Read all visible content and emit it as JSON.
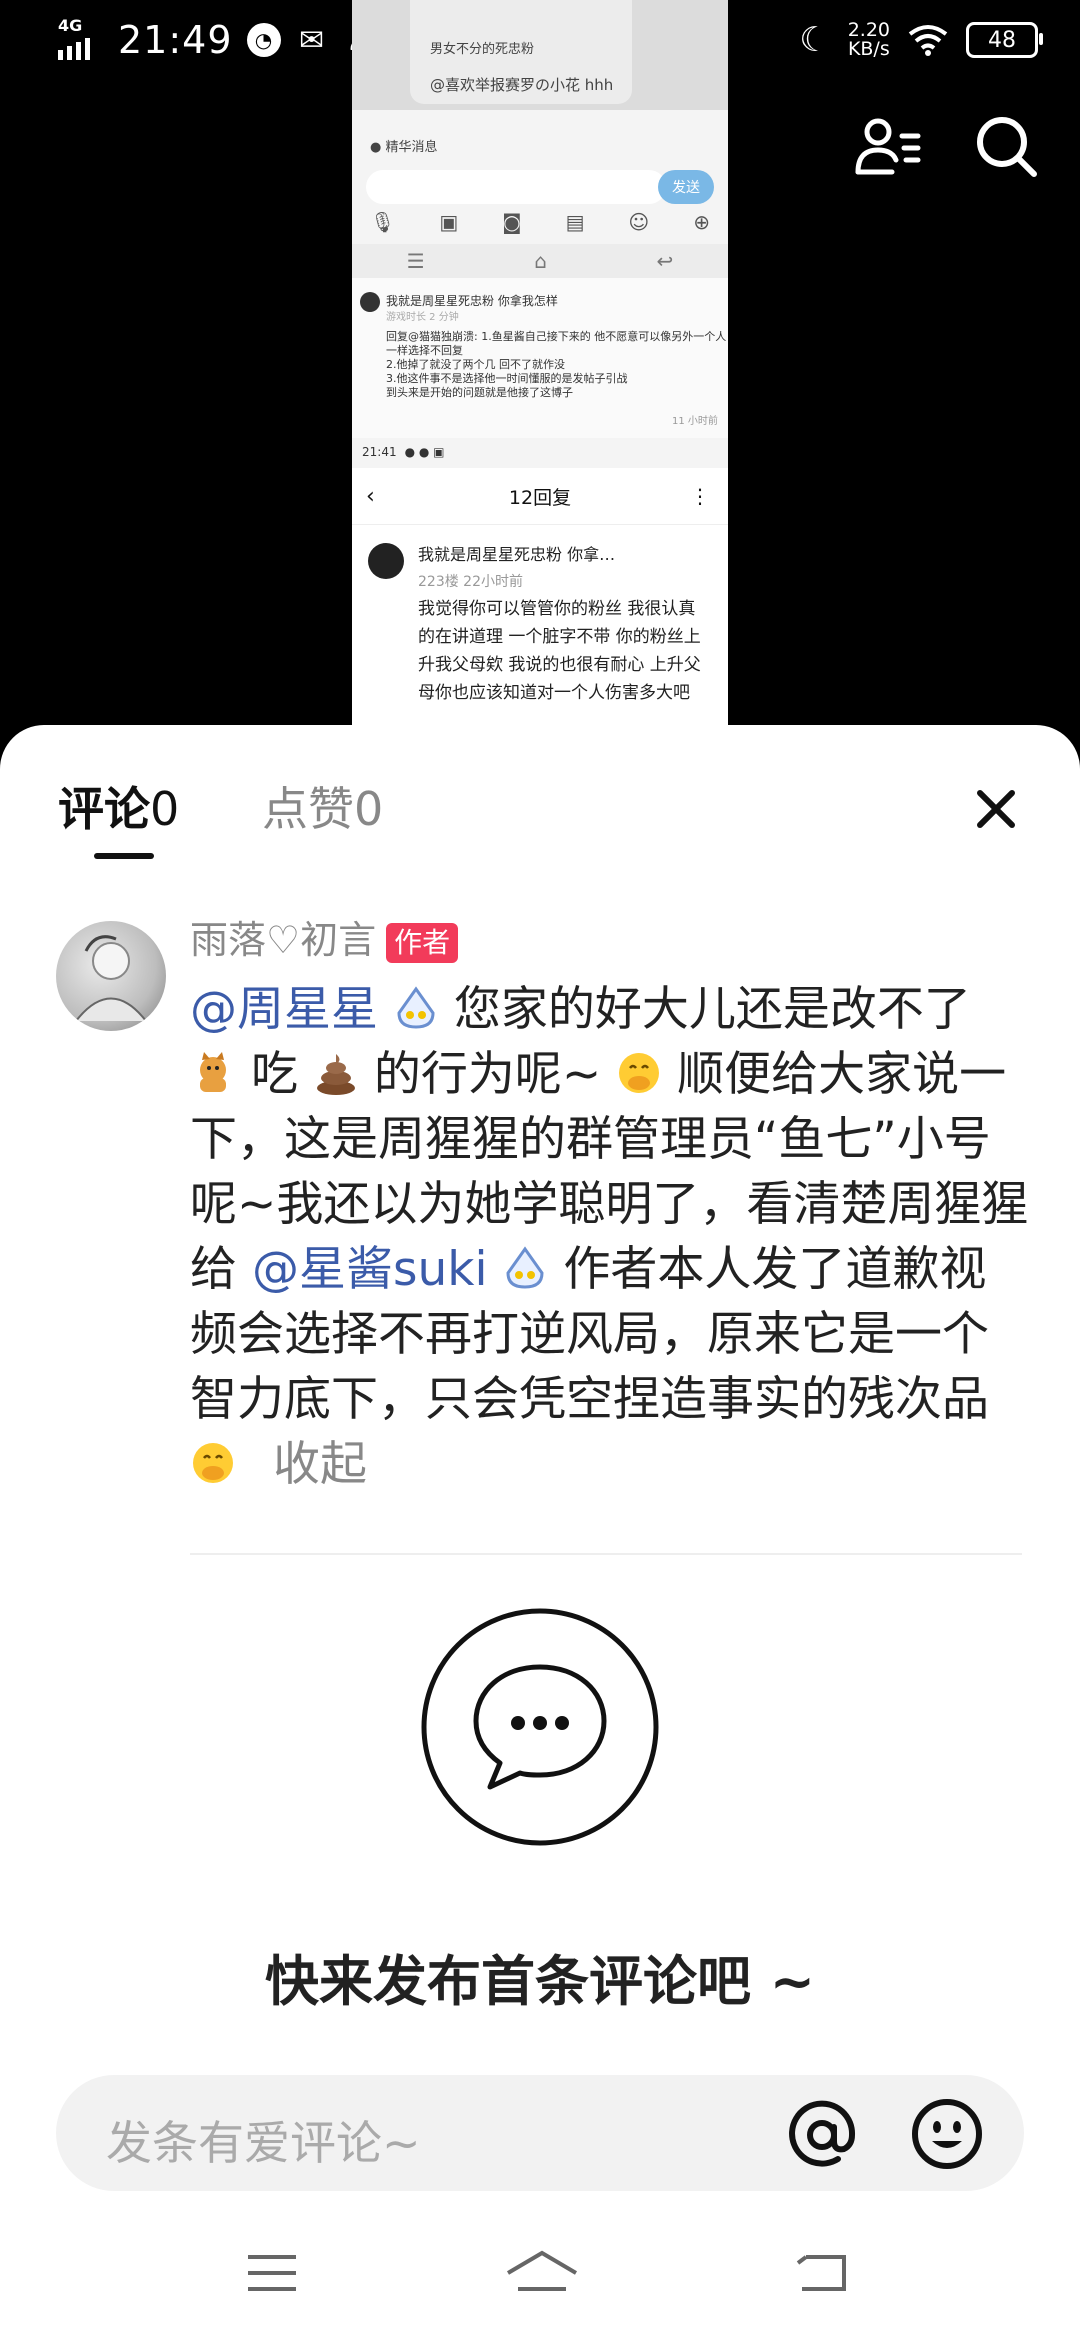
{
  "status_bar": {
    "network": "4G",
    "time": "21:49",
    "speed_value": "2.20",
    "speed_unit": "KB/s",
    "battery": "48"
  },
  "preview": {
    "card_line1": "男女不分的死忠粉",
    "card_line2": "@喜欢举报赛罗の小花 hhh",
    "badge": "精华消息",
    "send": "发送",
    "post_title": "我就是周星星死忠粉 你拿我怎样",
    "post_meta": "游戏时长 2 分钟",
    "post_lines": [
      "回复@猫猫独崩溃: 1.鱼星酱自己接下来的 他不愿意可以像另外一个人",
      "一样选择不回复",
      "2.他掉了就没了两个几 回不了就作没",
      "3.他这件事不是选择他一时间懂服的是发帖子引战",
      "到头来是开始的问题就是他接了这博子"
    ],
    "post_time": "11 小时前",
    "time2": "21:41",
    "header_title": "12回复",
    "reply_name": "我就是周星星死忠粉 你拿…",
    "reply_meta": "223楼  22小时前",
    "reply_body": "我觉得你可以管管你的粉丝 我很认真的在讲道理 一个脏字不带 你的粉丝上升我父母欸 我说的也很有耐心 上升父母你也应该知道对一个人伤害多大吧"
  },
  "sheet": {
    "tab_comments": "评论",
    "tab_comments_count": "0",
    "tab_likes": "点赞",
    "tab_likes_count": "0",
    "comment": {
      "author": "雨落♡初言",
      "author_tag": "作者",
      "mention1": "@周星星",
      "text1": " 您家的好大儿还是改不了",
      "text2": "吃",
      "text3": "的行为呢~",
      "text4": "顺便给大家说一下，这是周猩猩的群管理员“鱼七”小号呢~我还以为她学聪明了，看清楚周猩猩给",
      "mention2": "@星酱suki",
      "text5": " 作者本人发了道歉视频会选择不再打逆风局，原来它是一个智力底下，只会凭空捏造事实的残次品",
      "collapse": "收起"
    },
    "empty_text": "快来发布首条评论吧 ~",
    "input_placeholder": "发条有爱评论~"
  }
}
